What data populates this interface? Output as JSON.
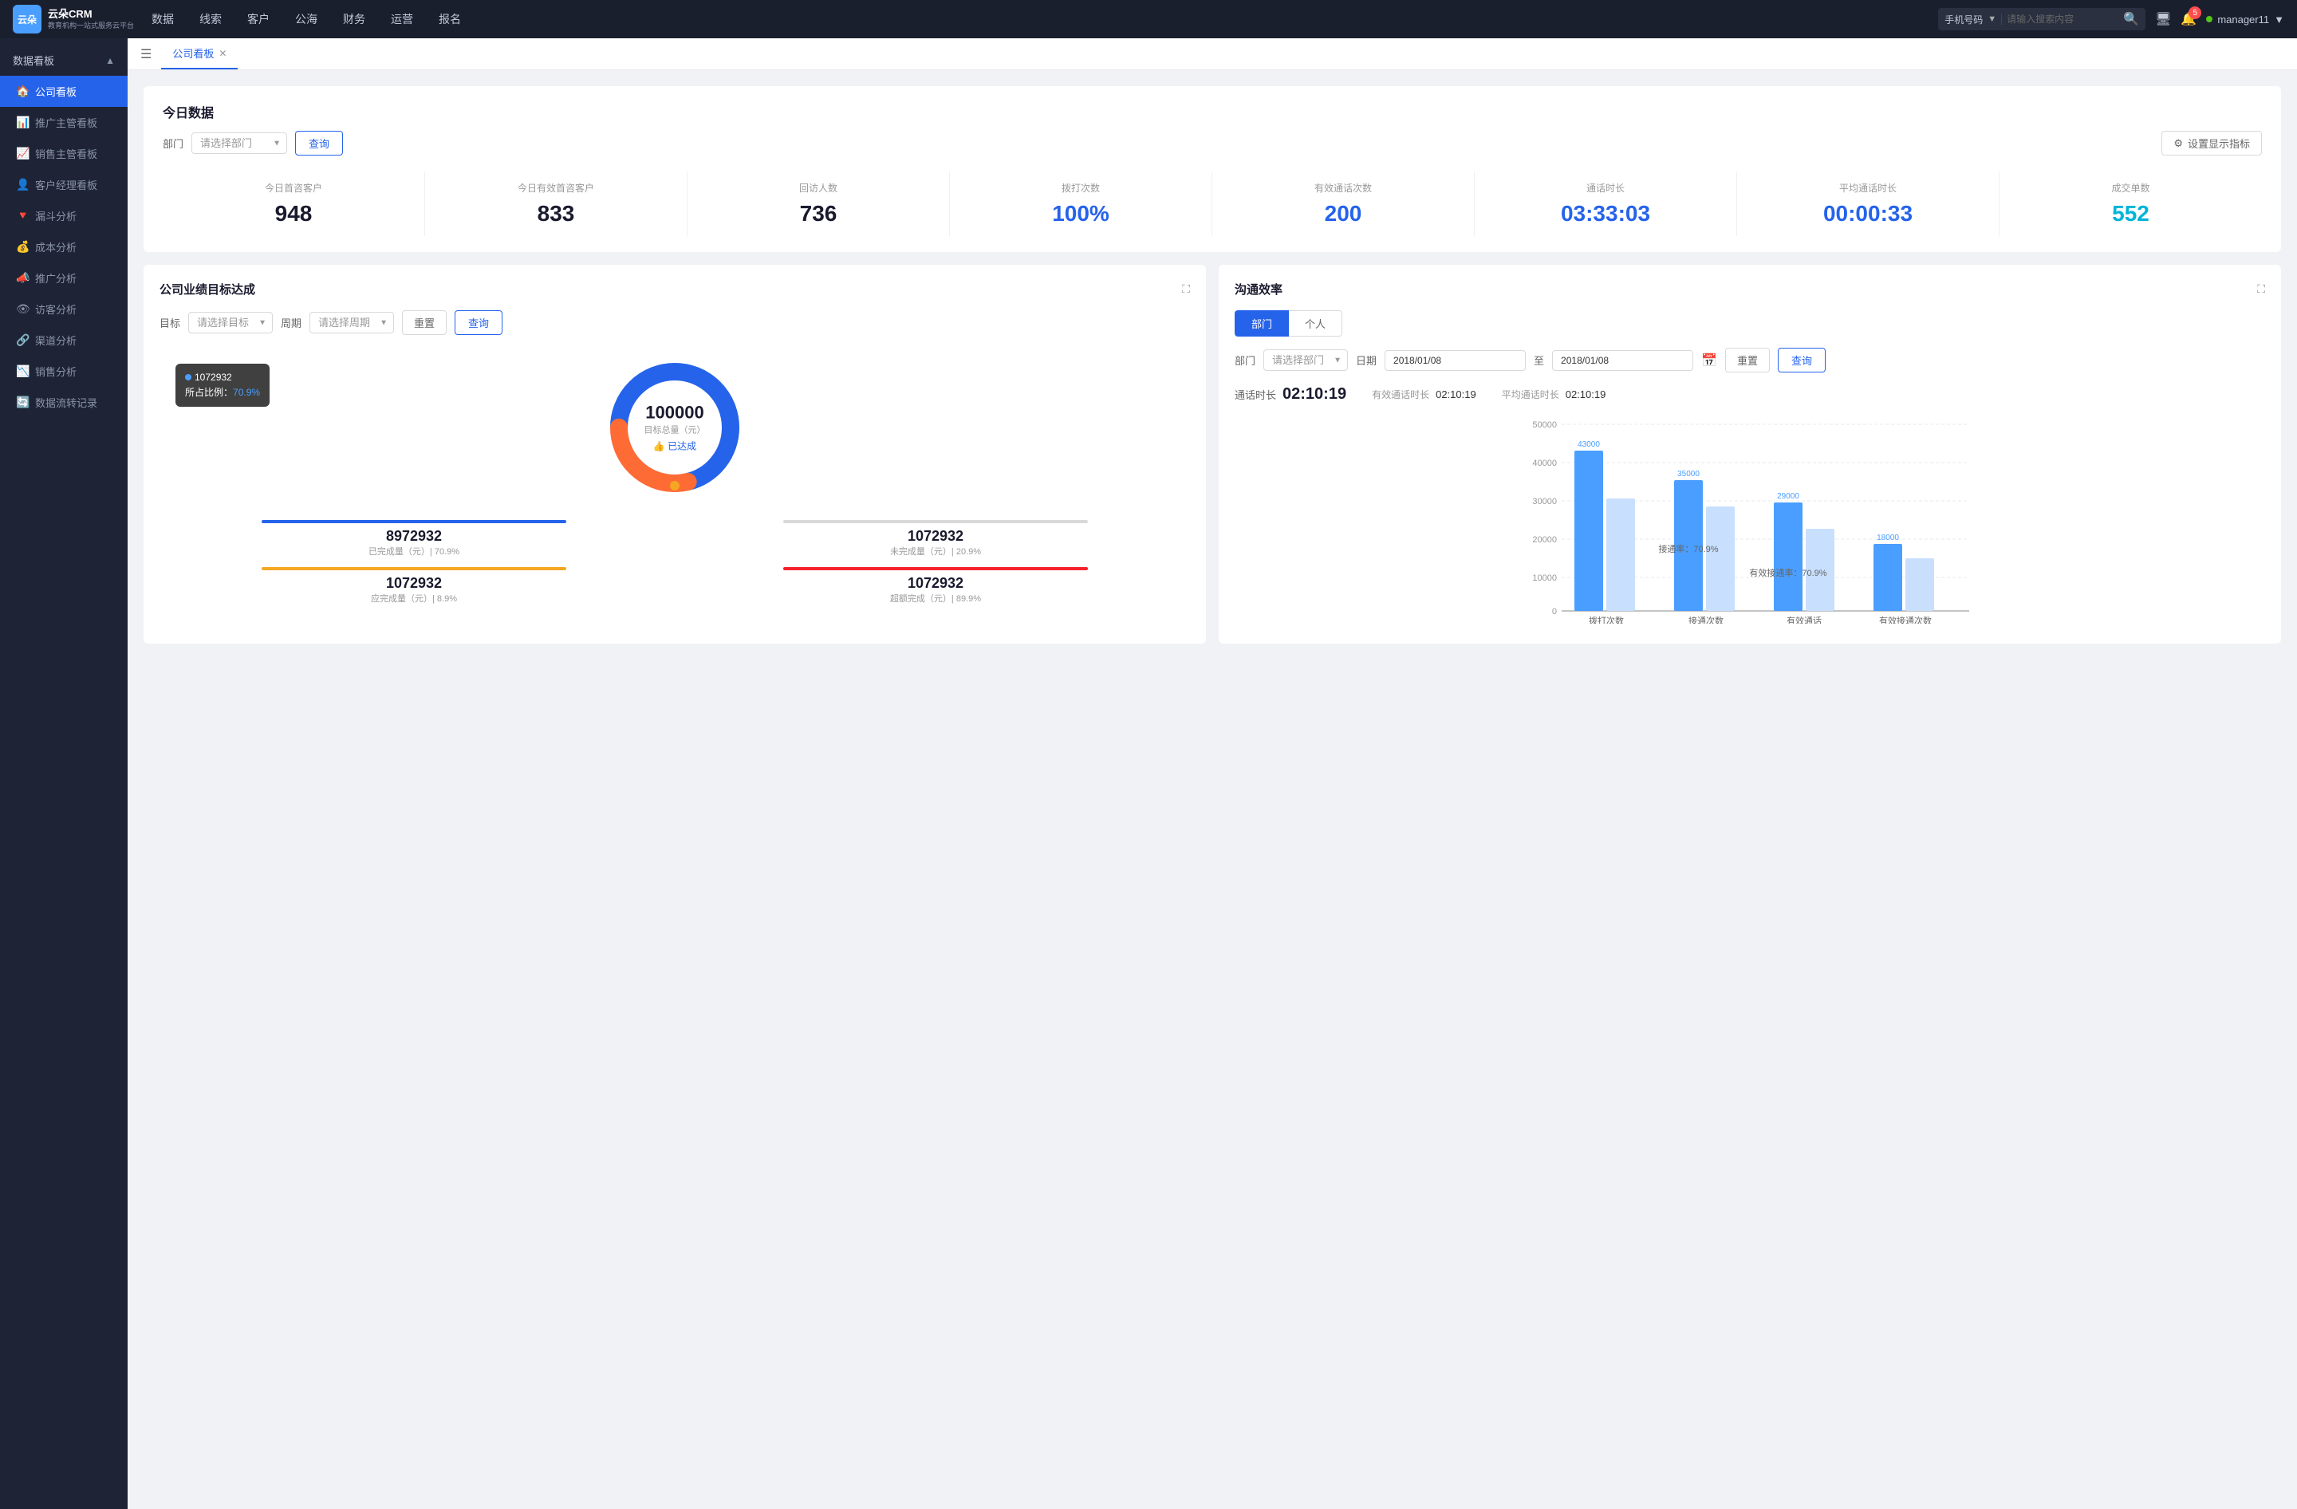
{
  "app": {
    "logo_text_line1": "云朵CRM",
    "logo_text_line2": "教育机构一站式服务云平台"
  },
  "nav": {
    "items": [
      "数据",
      "线索",
      "客户",
      "公海",
      "财务",
      "运营",
      "报名"
    ],
    "search_placeholder": "请输入搜索内容",
    "search_type": "手机号码",
    "notification_count": "5",
    "user": "manager11"
  },
  "sidebar": {
    "section_label": "数据看板",
    "items": [
      {
        "label": "公司看板",
        "active": true,
        "icon": "🏠"
      },
      {
        "label": "推广主管看板",
        "active": false,
        "icon": "📊"
      },
      {
        "label": "销售主管看板",
        "active": false,
        "icon": "📈"
      },
      {
        "label": "客户经理看板",
        "active": false,
        "icon": "👤"
      },
      {
        "label": "漏斗分析",
        "active": false,
        "icon": "🔻"
      },
      {
        "label": "成本分析",
        "active": false,
        "icon": "💰"
      },
      {
        "label": "推广分析",
        "active": false,
        "icon": "📣"
      },
      {
        "label": "访客分析",
        "active": false,
        "icon": "👁"
      },
      {
        "label": "渠道分析",
        "active": false,
        "icon": "🔗"
      },
      {
        "label": "销售分析",
        "active": false,
        "icon": "📉"
      },
      {
        "label": "数据流转记录",
        "active": false,
        "icon": "🔄"
      }
    ]
  },
  "tab": {
    "label": "公司看板"
  },
  "today": {
    "section_title": "今日数据",
    "filter_label": "部门",
    "select_placeholder": "请选择部门",
    "query_btn": "查询",
    "settings_btn": "设置显示指标",
    "metrics": [
      {
        "label": "今日首咨客户",
        "value": "948",
        "color": "dark"
      },
      {
        "label": "今日有效首咨客户",
        "value": "833",
        "color": "dark"
      },
      {
        "label": "回访人数",
        "value": "736",
        "color": "dark"
      },
      {
        "label": "拨打次数",
        "value": "100%",
        "color": "blue"
      },
      {
        "label": "有效通话次数",
        "value": "200",
        "color": "blue"
      },
      {
        "label": "通话时长",
        "value": "03:33:03",
        "color": "blue"
      },
      {
        "label": "平均通话时长",
        "value": "00:00:33",
        "color": "blue"
      },
      {
        "label": "成交单数",
        "value": "552",
        "color": "cyan"
      }
    ]
  },
  "goal_card": {
    "title": "公司业绩目标达成",
    "target_label": "目标",
    "target_placeholder": "请选择目标",
    "period_label": "周期",
    "period_placeholder": "请选择周期",
    "reset_btn": "重置",
    "query_btn": "查询",
    "tooltip": {
      "series": "1072932",
      "ratio_label": "所占比例：",
      "ratio_value": "70.9%"
    },
    "donut": {
      "value": "100000",
      "sub_label": "目标总量（元）",
      "status": "👍 已达成"
    },
    "stats": [
      {
        "value": "8972932",
        "label": "已完成量（元）| 70.9%",
        "bar_color": "#2563eb"
      },
      {
        "value": "1072932",
        "label": "未完成量（元）| 20.9%",
        "bar_color": "#d9d9d9"
      },
      {
        "value": "1072932",
        "label": "应完成量（元）| 8.9%",
        "bar_color": "#f5a623"
      },
      {
        "value": "1072932",
        "label": "超额完成（元）| 89.9%",
        "bar_color": "#f5222d"
      }
    ]
  },
  "comm_card": {
    "title": "沟通效率",
    "tab_dept": "部门",
    "tab_person": "个人",
    "dept_label": "部门",
    "dept_placeholder": "请选择部门",
    "date_label": "日期",
    "date_from": "2018/01/08",
    "date_to": "2018/01/08",
    "reset_btn": "重置",
    "query_btn": "查询",
    "call_duration_label": "通话时长",
    "call_duration_value": "02:10:19",
    "effective_label": "有效通话时长",
    "effective_value": "02:10:19",
    "avg_label": "平均通话时长",
    "avg_value": "02:10:19",
    "chart": {
      "y_labels": [
        "50000",
        "40000",
        "30000",
        "20000",
        "10000",
        "0"
      ],
      "bars": [
        {
          "group": "拨打次数",
          "items": [
            {
              "label": "43000",
              "value": 43000,
              "color": "#4a9eff"
            },
            {
              "label": "",
              "value": 30000,
              "color": "#c8dffe"
            }
          ]
        },
        {
          "group": "接通次数",
          "items": [
            {
              "label": "35000",
              "value": 35000,
              "color": "#4a9eff"
            },
            {
              "label": "",
              "value": 28000,
              "color": "#c8dffe"
            },
            {
              "label": "接通率：70.9%",
              "annotation": true
            }
          ]
        },
        {
          "group": "有效通话",
          "items": [
            {
              "label": "29000",
              "value": 29000,
              "color": "#4a9eff"
            },
            {
              "label": "",
              "value": 22000,
              "color": "#c8dffe"
            },
            {
              "label": "有效接通率：70.9%",
              "annotation": true
            }
          ]
        },
        {
          "group": "有效接通次数",
          "items": [
            {
              "label": "18000",
              "value": 18000,
              "color": "#4a9eff"
            },
            {
              "label": "",
              "value": 14000,
              "color": "#c8dffe"
            }
          ]
        }
      ],
      "x_labels": [
        "拨打次数",
        "接通次数",
        "有效通话",
        "有效接通次数"
      ]
    }
  }
}
